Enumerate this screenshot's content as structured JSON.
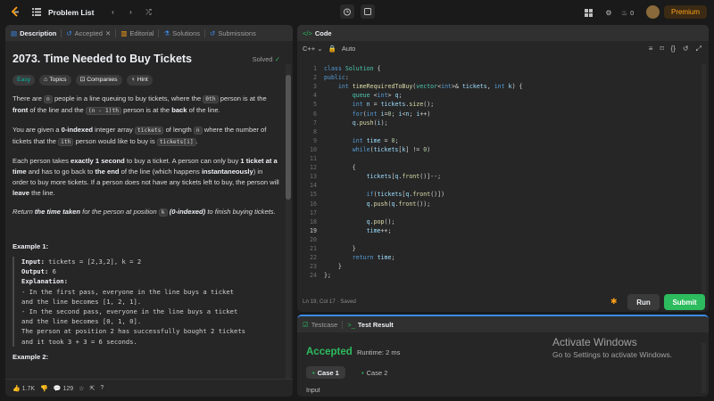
{
  "topbar": {
    "problem_list": "Problem List",
    "premium": "Premium",
    "streak": "0"
  },
  "left": {
    "tabs": [
      {
        "label": "Description"
      },
      {
        "label": "Accepted"
      },
      {
        "label": "Editorial"
      },
      {
        "label": "Solutions"
      },
      {
        "label": "Submissions"
      }
    ],
    "title": "2073. Time Needed to Buy Tickets",
    "solved": "Solved",
    "pills": {
      "easy": "Easy",
      "topics": "Topics",
      "companies": "Companies",
      "hint": "Hint"
    },
    "p1": {
      "a": "There are ",
      "n": "n",
      "b": " people in a line queuing to buy tickets, where the ",
      "ith": "0th",
      "c": " person is at the ",
      "front": "front",
      "d": " of the line and the ",
      "n1": "(n - 1)th",
      "e": " person is at the ",
      "back": "back",
      "f": " of the line."
    },
    "p2": {
      "a": "You are given a ",
      "zi": "0-indexed",
      "b": " integer array ",
      "tickets": "tickets",
      "c": " of length ",
      "n": "n",
      "d": " where the number of tickets that the ",
      "ith": "ith",
      "e": " person would like to buy is ",
      "ti": "tickets[i]",
      "f": "."
    },
    "p3": {
      "a": "Each person takes ",
      "bold1": "exactly 1 second",
      "b": " to buy a ticket. A person can only buy ",
      "bold2": "1 ticket at a time",
      "c": " and has to go back to ",
      "bold3": "the end",
      "d": " of the line (which happens ",
      "bold4": "instantaneously",
      "e": ") in order to buy more tickets. If a person does not have any tickets left to buy, the person will ",
      "bold5": "leave",
      "f": " the line."
    },
    "p4": {
      "a": "Return ",
      "bold1": "the time taken",
      "b": " for the person at position ",
      "k": "k",
      "bold2": " (0-indexed)",
      "c": " to finish buying tickets."
    },
    "ex1_title": "Example 1:",
    "ex1": {
      "input_label": "Input:",
      "input": " tickets = [2,3,2], k = 2",
      "output_label": "Output:",
      "output": " 6",
      "expl_label": "Explanation:",
      "l1": "- In the first pass, everyone in the line buys a ticket",
      "l2": "and the line becomes [1, 2, 1].",
      "l3": "- In the second pass, everyone in the line buys a ticket",
      "l4": "and the line becomes [0, 1, 0].",
      "l5": "The person at position 2 has successfully bought 2 tickets",
      "l6": "and it took 3 + 3 = 6 seconds."
    },
    "ex2_title": "Example 2:",
    "bottom": {
      "likes": "1.7K",
      "comments": "129"
    }
  },
  "right": {
    "code_tab": "Code",
    "lang": "C++",
    "auto": "Auto",
    "status": "Ln 19, Col 17  ·  Saved",
    "run": "Run",
    "submit": "Submit",
    "testcase_tab": "Testcase",
    "result_tab": "Test Result",
    "accepted": "Accepted",
    "runtime": "Runtime: 2 ms",
    "case1": "Case 1",
    "case2": "Case 2",
    "input": "Input",
    "watermark1": "Activate Windows",
    "watermark2": "Go to Settings to activate Windows."
  },
  "colors": {
    "accent": "#ffa116",
    "green": "#2cbb5d",
    "easy": "#00b8a3"
  }
}
